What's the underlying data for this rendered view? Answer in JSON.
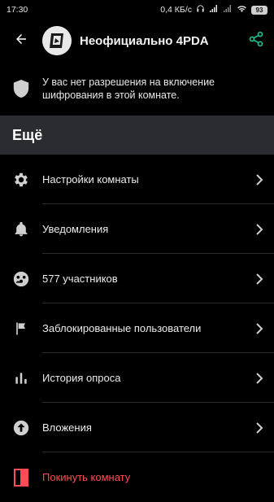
{
  "status_bar": {
    "time": "17:30",
    "network_speed": "0,4 КБ/с",
    "battery": "93"
  },
  "header": {
    "room_name": "Неофициально 4PDA"
  },
  "notice": {
    "text": "У вас нет разрешения на включение шифрования в этой комнате."
  },
  "section": {
    "title": "Ещё"
  },
  "menu": {
    "items": [
      {
        "label": "Настройки комнаты",
        "icon": "gear-icon"
      },
      {
        "label": "Уведомления",
        "icon": "bell-icon"
      },
      {
        "label": "577 участников",
        "icon": "members-icon"
      },
      {
        "label": "Заблокированные пользователи",
        "icon": "flag-icon"
      },
      {
        "label": "История опроса",
        "icon": "poll-chart-icon"
      },
      {
        "label": "Вложения",
        "icon": "upload-arrow-icon"
      },
      {
        "label": "Покинуть комнату",
        "icon": "leave-door-icon"
      }
    ]
  },
  "colors": {
    "accent_share": "#1fbd8b",
    "danger": "#ff4b55",
    "section_bg": "#2b2c30"
  }
}
